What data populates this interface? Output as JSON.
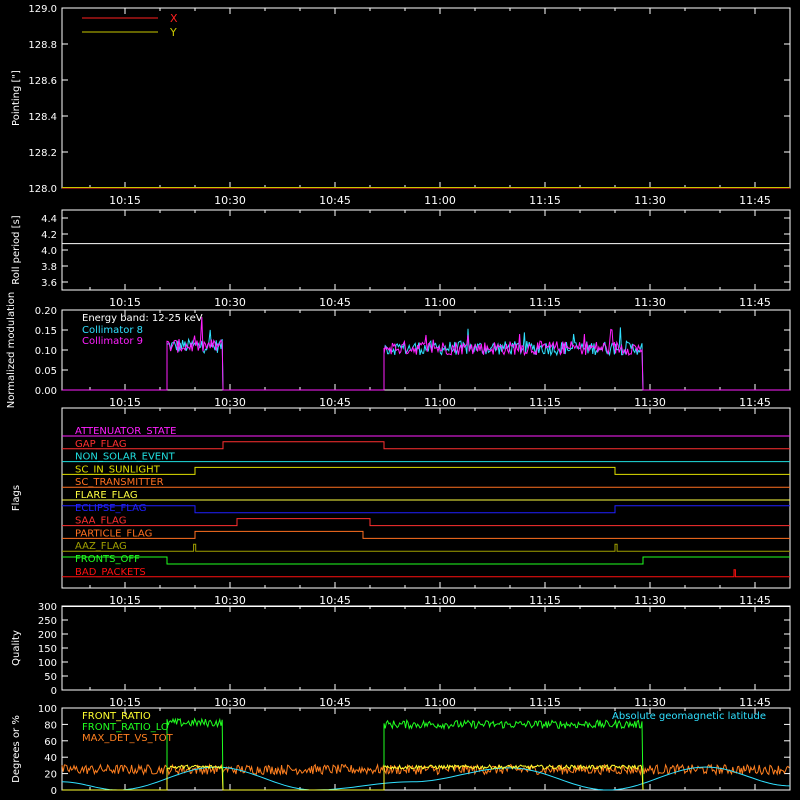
{
  "chart_data": [
    {
      "type": "line",
      "ylabel": "Pointing [\"]",
      "ylim": [
        128.0,
        129.0
      ],
      "y_ticks": [
        "128.0",
        "128.2",
        "128.4",
        "128.6",
        "128.8",
        "129.0"
      ],
      "x_ticks": [
        "10:15",
        "10:30",
        "10:45",
        "11:00",
        "11:15",
        "11:30",
        "11:45"
      ],
      "legend": [
        {
          "name": "X",
          "color": "#ff2020"
        },
        {
          "name": "Y",
          "color": "#c8c800"
        }
      ],
      "series": [
        {
          "name": "X",
          "color": "#ff2020",
          "x": [
            "10:06",
            "11:50"
          ],
          "values": [
            128.0,
            128.0
          ]
        },
        {
          "name": "Y",
          "color": "#c8c800",
          "x": [
            "10:06",
            "11:50"
          ],
          "values": [
            128.0,
            128.0
          ]
        }
      ]
    },
    {
      "type": "line",
      "ylabel": "Roll period [s]",
      "ylim": [
        3.5,
        4.5
      ],
      "y_ticks": [
        "3.6",
        "3.8",
        "4.0",
        "4.2",
        "4.4"
      ],
      "x_ticks": [
        "10:15",
        "10:30",
        "10:45",
        "11:00",
        "11:15",
        "11:30",
        "11:45"
      ],
      "series": [
        {
          "color": "#ffffff",
          "x": [
            "10:06",
            "11:50"
          ],
          "values": [
            4.08,
            4.08
          ]
        }
      ]
    },
    {
      "type": "line",
      "ylabel": "Normalized modulation",
      "ylim": [
        0.0,
        0.2
      ],
      "y_ticks": [
        "0.00",
        "0.05",
        "0.10",
        "0.15",
        "0.20"
      ],
      "x_ticks": [
        "10:15",
        "10:30",
        "10:45",
        "11:00",
        "11:15",
        "11:30",
        "11:45"
      ],
      "annotation": "Energy band: 12-25 keV",
      "legend": [
        {
          "name": "Collimator 8",
          "color": "#30e0ff"
        },
        {
          "name": "Collimator 9",
          "color": "#ff20ff"
        }
      ],
      "series": [
        {
          "name": "Collimator 8",
          "color": "#30e0ff",
          "segments": [
            [
              "10:21",
              "10:29",
              0.11
            ],
            [
              "10:52",
              "11:29",
              0.105
            ]
          ]
        },
        {
          "name": "Collimator 9",
          "color": "#ff20ff",
          "segments": [
            [
              "10:21",
              "10:29",
              0.11
            ],
            [
              "10:52",
              "11:29",
              0.105
            ]
          ]
        }
      ]
    },
    {
      "type": "line",
      "ylabel": "Flags",
      "x_ticks": [
        "10:15",
        "10:30",
        "10:45",
        "11:00",
        "11:15",
        "11:30",
        "11:45"
      ],
      "flags": [
        {
          "name": "ATTENUATOR_STATE",
          "color": "#ff20ff",
          "changes": []
        },
        {
          "name": "GAP_FLAG",
          "color": "#ff3030",
          "changes": [
            [
              "10:29",
              1
            ],
            [
              "10:52",
              0
            ]
          ]
        },
        {
          "name": "NON_SOLAR_EVENT",
          "color": "#20e0e0",
          "changes": []
        },
        {
          "name": "SC_IN_SUNLIGHT",
          "color": "#e0e000",
          "changes": [
            [
              "10:25",
              1
            ],
            [
              "11:25",
              0
            ]
          ]
        },
        {
          "name": "SC_TRANSMITTER",
          "color": "#ff7020",
          "changes": []
        },
        {
          "name": "FLARE_FLAG",
          "color": "#ffff40",
          "changes": []
        },
        {
          "name": "ECLIPSE_FLAG",
          "color": "#2020ff",
          "changes": [
            [
              "10:25",
              0
            ],
            [
              "11:25",
              1
            ]
          ]
        },
        {
          "name": "SAA_FLAG",
          "color": "#ff3030",
          "changes": [
            [
              "10:31",
              1
            ],
            [
              "10:50",
              0
            ]
          ]
        },
        {
          "name": "PARTICLE_FLAG",
          "color": "#ff7020",
          "changes": [
            [
              "10:25",
              1
            ],
            [
              "10:49",
              0
            ]
          ]
        },
        {
          "name": "AAZ_FLAG",
          "color": "#a0a000",
          "changes": [
            [
              "10:24.8",
              1
            ],
            [
              "10:25.1",
              0
            ],
            [
              "11:25",
              1
            ],
            [
              "11:25.3",
              0
            ]
          ]
        },
        {
          "name": "FRONTS_OFF",
          "color": "#20ff20",
          "changes": [
            [
              "10:21",
              0
            ],
            [
              "11:29",
              1
            ]
          ]
        },
        {
          "name": "BAD_PACKETS",
          "color": "#ff1010",
          "changes": [
            [
              "11:42",
              1
            ],
            [
              "11:42.2",
              0
            ]
          ]
        }
      ]
    },
    {
      "type": "line",
      "ylabel": "Quality",
      "ylim": [
        0,
        300
      ],
      "y_ticks": [
        "0",
        "50",
        "100",
        "150",
        "200",
        "250",
        "300"
      ],
      "x_ticks": [
        "10:15",
        "10:30",
        "10:45",
        "11:00",
        "11:15",
        "11:30",
        "11:45"
      ],
      "series": [
        {
          "color": "#ffffff",
          "x": [
            "10:06",
            "11:50"
          ],
          "values": [
            300,
            300
          ]
        }
      ]
    },
    {
      "type": "line",
      "ylabel": "Degrees or %",
      "ylim": [
        0,
        100
      ],
      "y_ticks": [
        "0",
        "20",
        "40",
        "60",
        "80",
        "100"
      ],
      "x_ticks": [
        "10:15",
        "10:30",
        "10:45",
        "11:00",
        "11:15",
        "11:30",
        "11:45"
      ],
      "legend": [
        {
          "name": "FRONT_RATIO",
          "color": "#ffff30"
        },
        {
          "name": "FRONT_RATIO_LO",
          "color": "#20ff20"
        },
        {
          "name": "MAX_DET_VS_TOT",
          "color": "#ff8020"
        },
        {
          "name": "Absolute geomagnetic latitude",
          "color": "#30e0ff"
        }
      ],
      "series": [
        {
          "name": "FRONT_RATIO",
          "color": "#ffff30",
          "segments": [
            [
              "10:21",
              "10:29",
              28
            ],
            [
              "10:52",
              "11:29",
              28
            ]
          ]
        },
        {
          "name": "FRONT_RATIO_LO",
          "color": "#20ff20",
          "segments": [
            [
              "10:21",
              "10:29",
              82
            ],
            [
              "10:52",
              "11:29",
              80
            ]
          ]
        },
        {
          "name": "MAX_DET_VS_TOT",
          "color": "#ff8020",
          "range": [
            "10:06",
            "11:50"
          ],
          "level": 25
        },
        {
          "name": "Absolute geomagnetic latitude",
          "color": "#30e0ff",
          "x": [
            "10:06",
            "10:14",
            "10:28",
            "10:42",
            "10:56",
            "11:10",
            "11:24",
            "11:38",
            "11:50"
          ],
          "values": [
            10,
            0,
            28,
            0,
            10,
            27,
            0,
            28,
            5
          ]
        }
      ]
    }
  ]
}
